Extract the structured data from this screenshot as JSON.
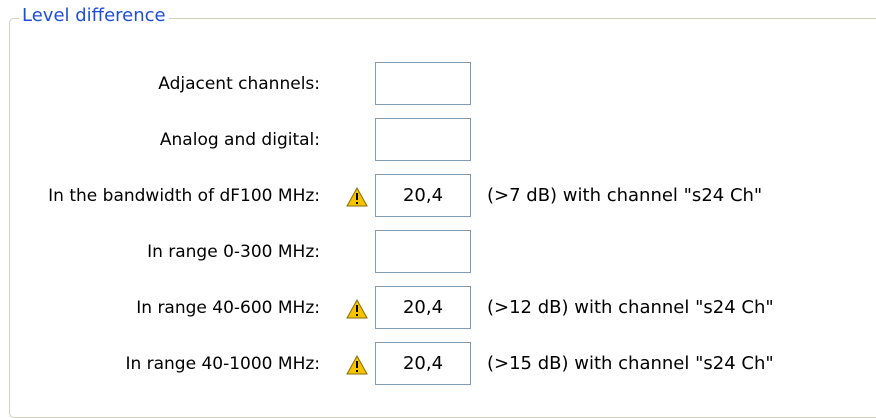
{
  "group": {
    "title": "Level difference"
  },
  "rows": [
    {
      "label": "Adjacent channels:",
      "value": "",
      "warning": false,
      "note": ""
    },
    {
      "label": "Analog and digital:",
      "value": "",
      "warning": false,
      "note": ""
    },
    {
      "label": "In the bandwidth of dF100 MHz:",
      "value": "20,4",
      "warning": true,
      "note": "(>7 dB)  with channel \"s24 Ch\""
    },
    {
      "label": "In range 0-300 MHz:",
      "value": "",
      "warning": false,
      "note": ""
    },
    {
      "label": "In range 40-600 MHz:",
      "value": "20,4",
      "warning": true,
      "note": "(>12 dB)  with channel \"s24 Ch\""
    },
    {
      "label": "In range 40-1000 MHz:",
      "value": "20,4",
      "warning": true,
      "note": "(>15 dB)  with channel \"s24 Ch\""
    }
  ],
  "colors": {
    "title": "#1f4fd6",
    "warning_fill": "#f5c400",
    "field_border": "#7f9db9"
  },
  "icons": {
    "warning": "warning-icon"
  }
}
